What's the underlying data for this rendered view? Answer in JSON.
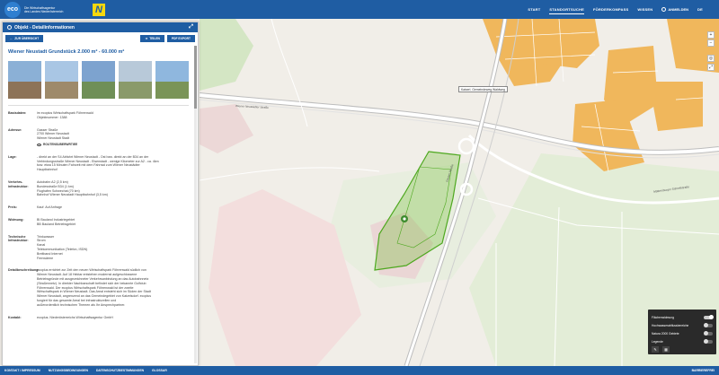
{
  "header": {
    "logo_eco": "eco",
    "logo_line1": "Die Wirtschaftsagentur",
    "logo_line2": "des Landes Niederösterreich",
    "logo_n": "N",
    "nav": [
      "START",
      "STANDORTSUCHE",
      "FÖRDERKOMPASS",
      "WISSEN"
    ],
    "active_nav": "STANDORTSUCHE",
    "login": "ANMELDEN",
    "lang": "DE"
  },
  "panel": {
    "title": "Objekt - Detailinformationen",
    "back_button": "ZUR ÜBERSICHT",
    "share_button": "TEILEN",
    "pdf_button": "PDF EXPORT",
    "object_title": "Wiener Neustadt Grundstück 2.000 m² - 60.000 m²",
    "details": [
      {
        "label": "Basisdaten:",
        "lines": [
          "im ecoplus Wirtschaftspark Föhrenwald",
          "Objektnummer: 1388"
        ]
      },
      {
        "label": "Adresse:",
        "lines": [
          "Gasser Straße",
          "2700 Wiener Neustadt",
          "Wiener Neustadt Stadt"
        ],
        "link": "ROUTENSUBERWRTIEE"
      },
      {
        "label": "Lage:",
        "lines": [
          "- direkt an der S4 Abfahrt Wiener Neustadt - Ost bzw. direkt an der B34 an der",
          "Verbindungsstraße Wiener Neustadt - Eisenstadt - wenige Kilometer zur A2 - ca. 4km",
          "bzw. etwa 15 Minuten Fahrzeit mit dem Fahrrad zum Wiener Neustädter",
          "Hauptbahnhof"
        ]
      },
      {
        "label": "Verkehrs-infrastruktur:",
        "lines": [
          "Autobahn A2 (2,5 km)",
          "Bundesstraße B34 (1 km)",
          "Flughafen Schwechat (70 km)",
          "Bahnhof Wiener Neustadt Hauptbahnhof (3,5 km)"
        ]
      },
      {
        "label": "Preis:",
        "lines": [
          "Kauf: Auf Anfrage"
        ]
      },
      {
        "label": "Widmung:",
        "lines": [
          "BI Bauland Industriegebiet",
          "BB Bauland Betriebsgebiet"
        ]
      },
      {
        "label": "Technische Infrastruktur:",
        "lines": [
          "Trinkwasser",
          "Strom",
          "Kanal",
          "Telekommunikation (Telefon, ISDN)",
          "Breitband Internet",
          "Fernwärme"
        ]
      },
      {
        "label": "Detailbeschreibung:",
        "lines": [
          "ecoplus errichtet zur Zeit den neuen Wirtschaftspark Föhrenwald südlich von",
          "Wiener Neustadt. Auf 18 Hektar entstehen modernst aufgeschlossene",
          "Betriebsgründe mit ausgezeichneter Verkehrsanbindung an das Autobahnnetz",
          "(Straßennetz). In direkter Nachbarschaft befindet sich der bekannte Golfclub",
          "Föhrenwald. Der ecoplus Wirtschaftspark Föhrenwald ist der zweite",
          "Wirtschaftspark in Wiener Neustadt. Das Areal entsteht sich im Süden der Stadt",
          "Wiener Neustadt, angrenzend an das Gemeindegebiet von Katzelsdorf. ecoplus",
          "fungiert für das gesamte Areal bei infrastrukturellen und",
          "außerordentlich technischen Themen als Ihr Ansprechpartner."
        ]
      },
      {
        "label": "Kontakt:",
        "lines": [
          "ecoplus. Niederösterreichs Wirtschaftsagentur GmbH"
        ]
      }
    ]
  },
  "map": {
    "poi_label": "Kaiserl. Gemeindeweg Waldweg",
    "road_labels": [
      "Wiener Neustädter Straße",
      "Gasser Straße",
      "Mattersburger Schnellstraße"
    ]
  },
  "layers": {
    "items": [
      {
        "label": "Flächenwidmung",
        "on": true
      },
      {
        "label": "Hochwasserabflussbereiche",
        "on": false
      },
      {
        "label": "Natura 2000 Gebiete",
        "on": false
      },
      {
        "label": "Legende",
        "on": false
      }
    ]
  },
  "footer": {
    "items": [
      "KONTAKT / IMPRESSUM",
      "NUTZUNGSBEDINGUNGEN",
      "DATENSCHUTZBESTIMMUNGEN",
      "GLOSSAR"
    ],
    "right": "BARRIEREFREI"
  },
  "colors": {
    "brand_blue": "#1f5da3",
    "logo_yellow": "#f6d80e",
    "industrial_orange": "#f0b75c",
    "parcel_green": "#7bc043"
  }
}
